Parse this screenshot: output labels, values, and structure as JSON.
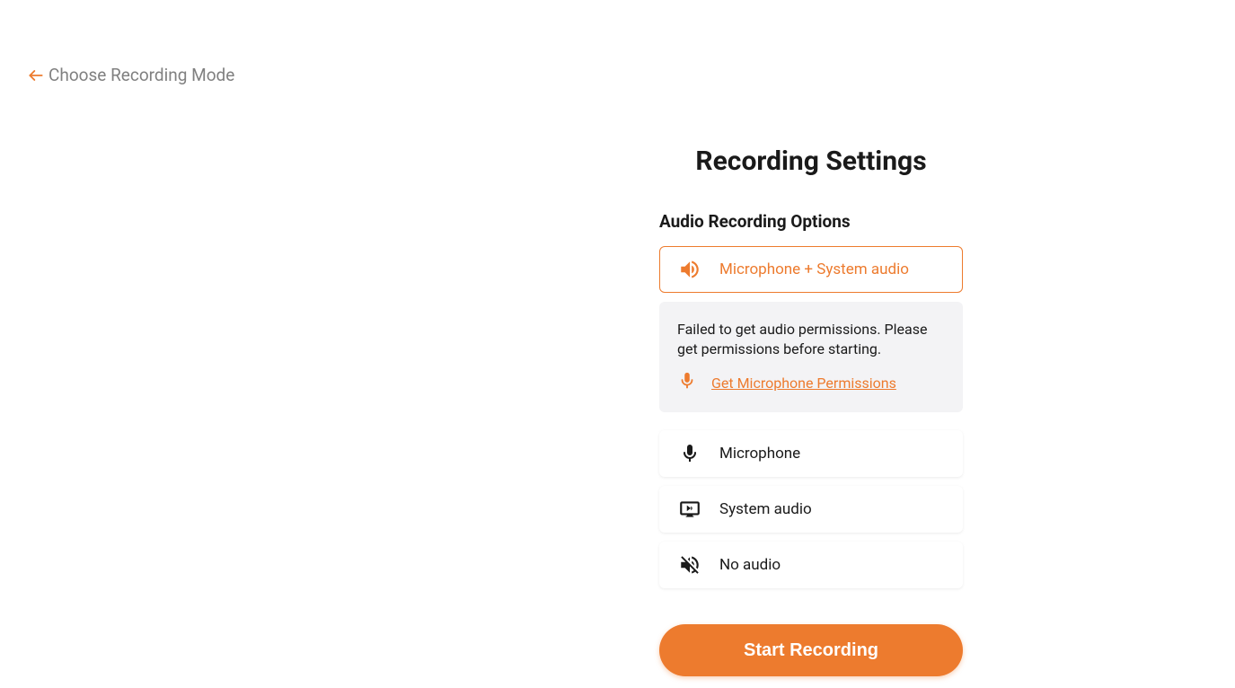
{
  "back": {
    "label": "Choose Recording Mode"
  },
  "settings": {
    "title": "Recording Settings",
    "section_label": "Audio Recording Options",
    "options": {
      "mic_system": "Microphone + System audio",
      "mic": "Microphone",
      "system": "System audio",
      "none": "No audio"
    },
    "warning": {
      "text": "Failed to get audio permissions. Please get permissions before starting.",
      "link_label": "Get Microphone Permissions"
    },
    "start_button": "Start Recording"
  },
  "colors": {
    "accent": "#ed7b2e"
  }
}
